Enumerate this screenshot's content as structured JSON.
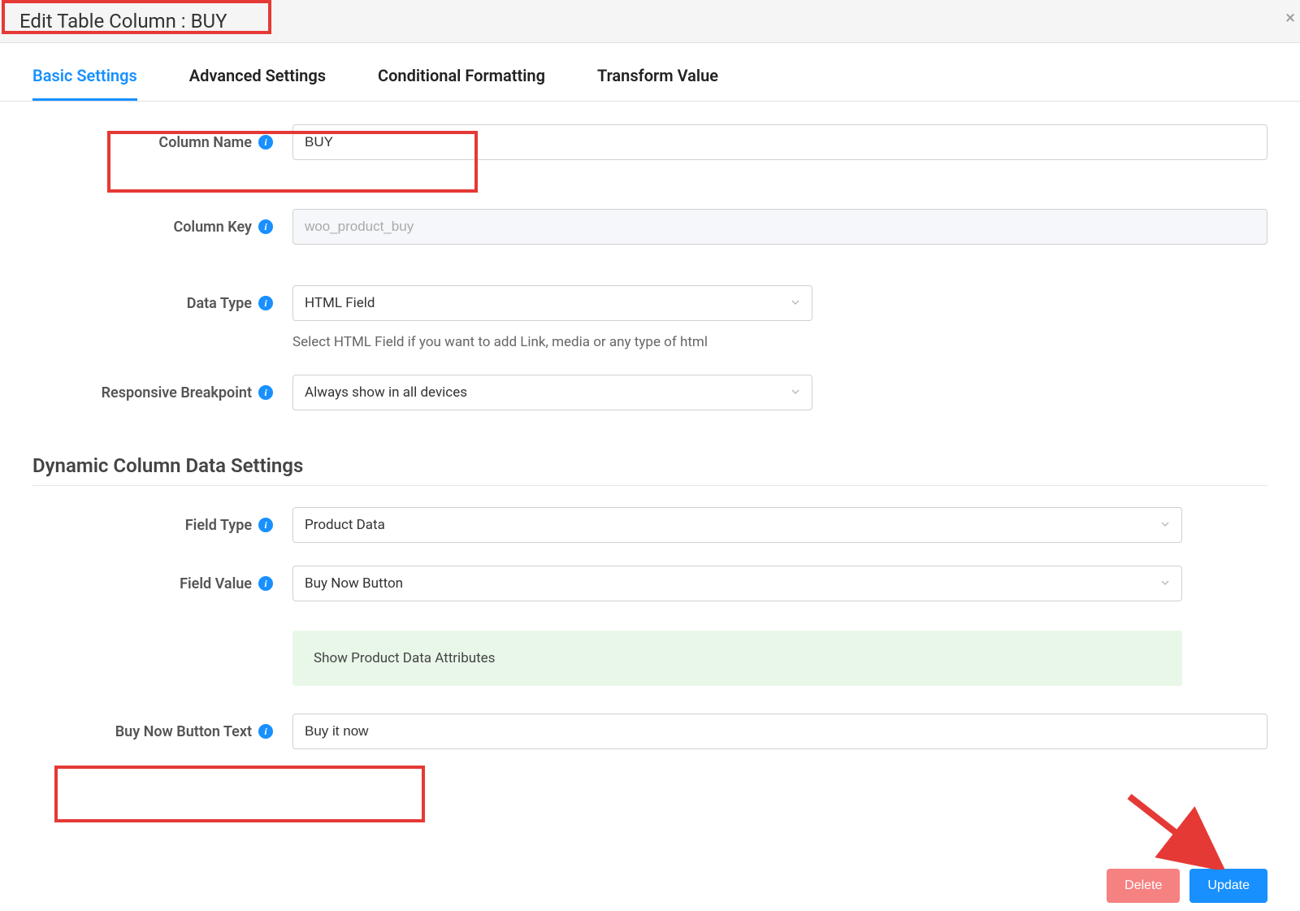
{
  "header": {
    "title": "Edit Table Column : BUY",
    "close": "×"
  },
  "tabs": {
    "basic": "Basic Settings",
    "advanced": "Advanced Settings",
    "conditional": "Conditional Formatting",
    "transform": "Transform Value"
  },
  "labels": {
    "column_name": "Column Name",
    "column_key": "Column Key",
    "data_type": "Data Type",
    "responsive": "Responsive Breakpoint",
    "field_type": "Field Type",
    "field_value": "Field Value",
    "buy_now_text": "Buy Now Button Text"
  },
  "values": {
    "column_name": "BUY",
    "column_key": "woo_product_buy",
    "data_type": "HTML Field",
    "responsive": "Always show in all devices",
    "field_type": "Product Data",
    "field_value": "Buy Now Button",
    "buy_now_text": "Buy it now"
  },
  "help": {
    "data_type": "Select HTML Field if you want to add Link, media or any type of html"
  },
  "section": {
    "dynamic_heading": "Dynamic Column Data Settings",
    "attr_banner": "Show Product Data Attributes"
  },
  "actions": {
    "delete": "Delete",
    "update": "Update"
  }
}
